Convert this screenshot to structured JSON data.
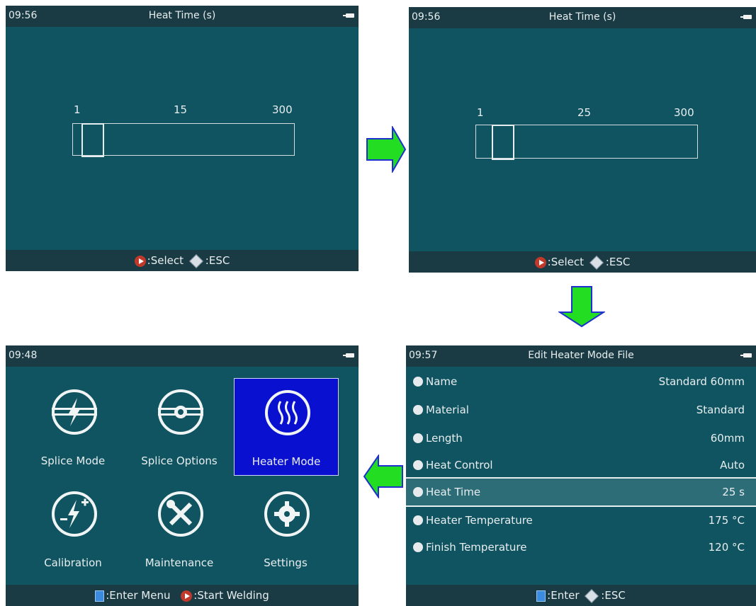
{
  "panel1": {
    "time": "09:56",
    "title": "Heat Time (s)",
    "min": "1",
    "cur": "15",
    "max": "300",
    "select_label": ":Select",
    "esc_label": ":ESC"
  },
  "panel2": {
    "time": "09:56",
    "title": "Heat Time (s)",
    "min": "1",
    "cur": "25",
    "max": "300",
    "select_label": ":Select",
    "esc_label": ":ESC"
  },
  "panel3": {
    "time": "09:48",
    "tiles": [
      {
        "label": "Splice Mode",
        "icon": "splice-mode-icon"
      },
      {
        "label": "Splice Options",
        "icon": "splice-options-icon"
      },
      {
        "label": "Heater Mode",
        "icon": "heater-mode-icon"
      },
      {
        "label": "Calibration",
        "icon": "calibration-icon"
      },
      {
        "label": "Maintenance",
        "icon": "maintenance-icon"
      },
      {
        "label": "Settings",
        "icon": "settings-icon"
      }
    ],
    "enter_label": ":Enter Menu",
    "start_label": ":Start Welding"
  },
  "panel4": {
    "time": "09:57",
    "title": "Edit Heater Mode File",
    "rows": [
      {
        "name": "Name",
        "value": "Standard 60mm"
      },
      {
        "name": "Material",
        "value": "Standard"
      },
      {
        "name": "Length",
        "value": "60mm"
      },
      {
        "name": "Heat Control",
        "value": "Auto"
      },
      {
        "name": "Heat Time",
        "value": "25 s"
      },
      {
        "name": "Heater Temperature",
        "value": "175 °C"
      },
      {
        "name": "Finish Temperature",
        "value": "120 °C"
      }
    ],
    "enter_label": ":Enter",
    "esc_label": ":ESC"
  },
  "colors": {
    "screen": "#0f5460",
    "bars": "#1a3b44",
    "selected_tile": "#0a10d0",
    "arrow_fill": "#22dd22",
    "arrow_outline": "#1f2fd0"
  }
}
